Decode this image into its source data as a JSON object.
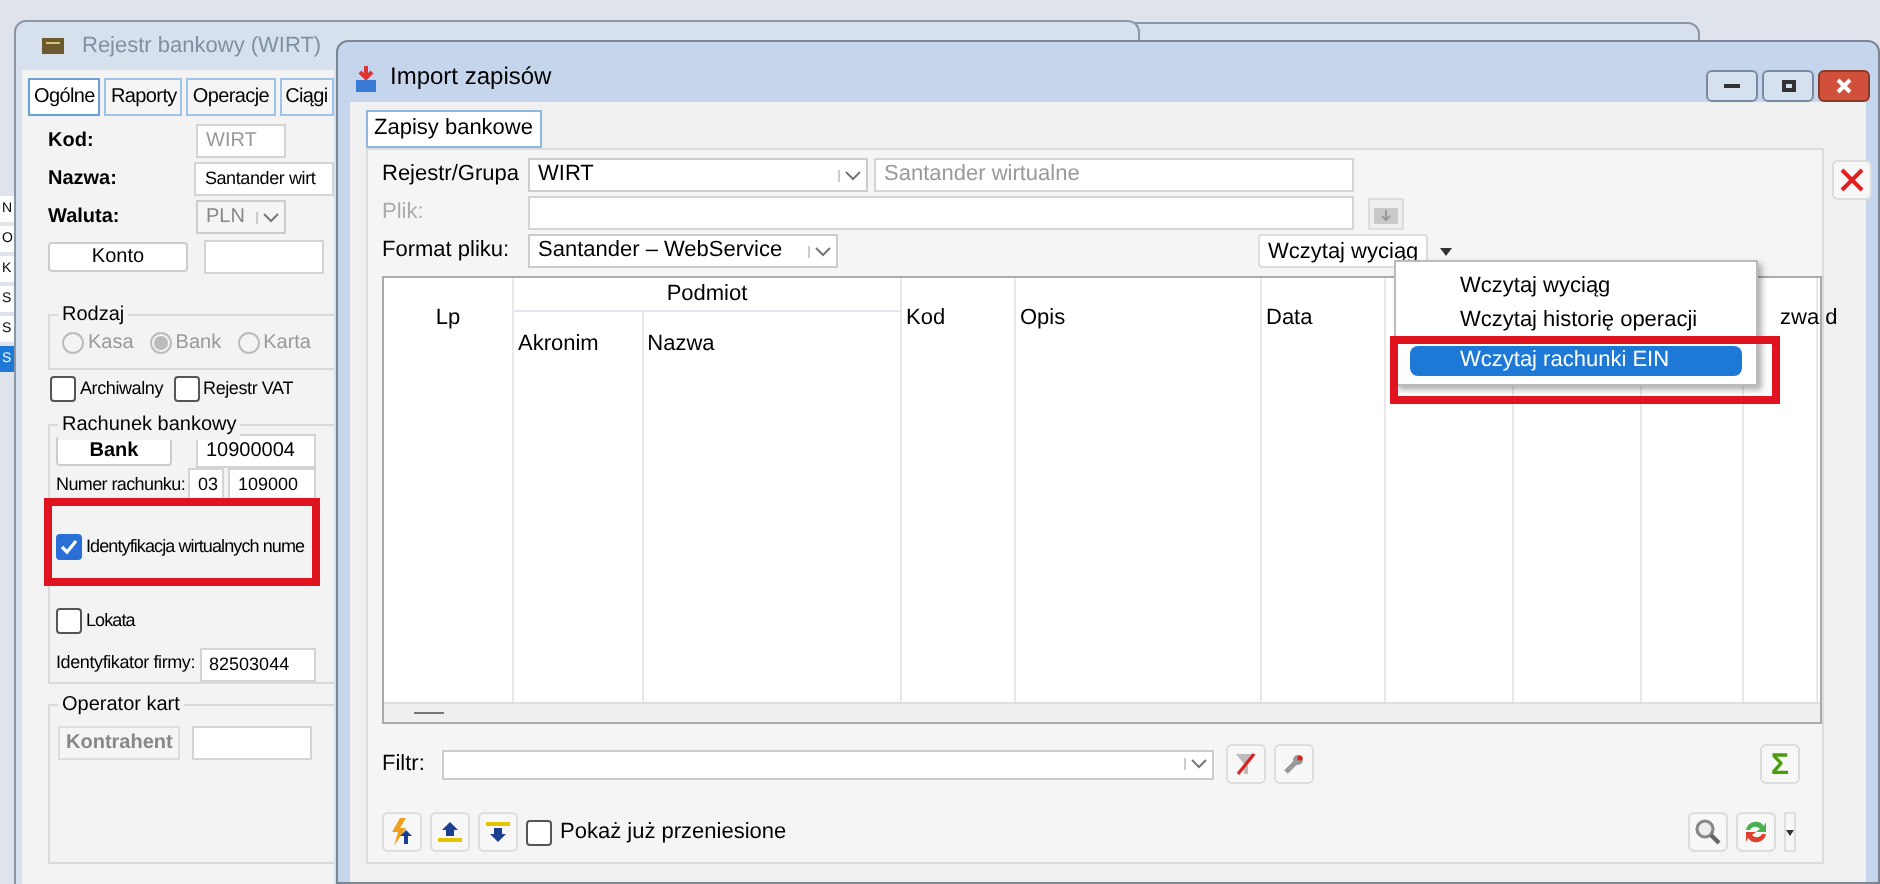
{
  "side_list": [
    {
      "text": "N",
      "selected": false
    },
    {
      "text": "O",
      "selected": false
    },
    {
      "text": "K",
      "selected": false
    },
    {
      "text": "S",
      "selected": false
    },
    {
      "text": "S",
      "selected": false
    },
    {
      "text": "S",
      "selected": true
    }
  ],
  "register_window": {
    "title": "Rejestr bankowy (WIRT)",
    "tabs": [
      {
        "label": "Ogólne",
        "selected": true
      },
      {
        "label": "Raporty",
        "selected": false
      },
      {
        "label": "Operacje",
        "selected": false
      },
      {
        "label": "Ciągi",
        "selected": false
      }
    ],
    "kod": {
      "label": "Kod:",
      "value": "WIRT"
    },
    "nazwa": {
      "label": "Nazwa:",
      "value": "Santander wirt"
    },
    "waluta": {
      "label": "Waluta:",
      "value": "PLN"
    },
    "konto_button": "Konto",
    "rodzaj": {
      "title": "Rodzaj",
      "disabled": true,
      "options": [
        {
          "label": "Kasa",
          "selected": false
        },
        {
          "label": "Bank",
          "selected": true
        },
        {
          "label": "Karta",
          "selected": false
        }
      ]
    },
    "checkboxes": [
      {
        "label": "Archiwalny",
        "checked": false
      },
      {
        "label": "Rejestr VAT",
        "checked": false
      }
    ],
    "rachunek": {
      "title": "Rachunek bankowy",
      "bank_button": "Bank",
      "bank_value": "10900004",
      "numer_label": "Numer rachunku:",
      "numer_values": [
        "03",
        "109000"
      ],
      "options": [
        {
          "label": "Identyfikacja wirtualnych nume",
          "checked": true
        },
        {
          "label": "Lokata",
          "checked": false
        }
      ],
      "identyfikator_label": "Identyfikator firmy:",
      "identyfikator_value": "82503044"
    },
    "operator": {
      "title": "Operator kart",
      "button": "Kontrahent"
    }
  },
  "import_window": {
    "title": "Import zapisów",
    "tabs": [
      {
        "label": "Zapisy bankowe",
        "selected": true
      }
    ],
    "rejestr": {
      "label": "Rejestr/Grupa",
      "value": "WIRT",
      "name": "Santander wirtualne"
    },
    "plik": {
      "label": "Plik:",
      "disabled": true
    },
    "format": {
      "label": "Format pliku:",
      "value": "Santander – WebService"
    },
    "load_button": "Wczytaj wyciąg",
    "menu": [
      {
        "label": "Wczytaj wyciąg",
        "selected": false
      },
      {
        "label": "Wczytaj historię operacji",
        "selected": false
      },
      {
        "label": "Wczytaj rachunki EIN",
        "selected": true
      }
    ],
    "table": {
      "columns": [
        {
          "label": "Lp"
        },
        {
          "label": "Podmiot",
          "children": [
            {
              "label": "Akronim"
            },
            {
              "label": "Nazwa"
            }
          ]
        },
        {
          "label": "Kod"
        },
        {
          "label": "Opis"
        },
        {
          "label": "Data"
        },
        {
          "label": "zwa d"
        }
      ]
    },
    "filter": {
      "label": "Filtr:"
    },
    "sum_button": "Σ",
    "show_transferred": {
      "label": "Pokaż już przeniesione",
      "checked": false
    }
  }
}
